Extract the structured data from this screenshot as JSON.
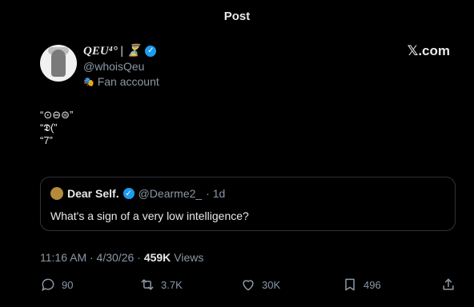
{
  "header": {
    "title": "Post"
  },
  "brand": {
    "label": "𝕏.com"
  },
  "author": {
    "display_name": "QEU⁴° | ⏳",
    "handle": "@whoisQeu",
    "label": "Fan account"
  },
  "post": {
    "lines": [
      "“⊙⊖⊜”",
      "“𝕯(”",
      "“7”"
    ]
  },
  "quote": {
    "name": "Dear Self.",
    "handle": "@Dearme2_",
    "time": "· 1d",
    "text": "What's a sign of a very low intelligence?"
  },
  "meta": {
    "timestamp": "11:16 AM · 4/30/26 ·",
    "views_count": "459K",
    "views_label": "Views"
  },
  "actions": {
    "replies": "90",
    "reposts": "3.7K",
    "likes": "30K",
    "bookmarks": "496"
  },
  "colors": {
    "verified": "#1d9bf0",
    "muted": "#8b98a5",
    "background": "#000000"
  }
}
